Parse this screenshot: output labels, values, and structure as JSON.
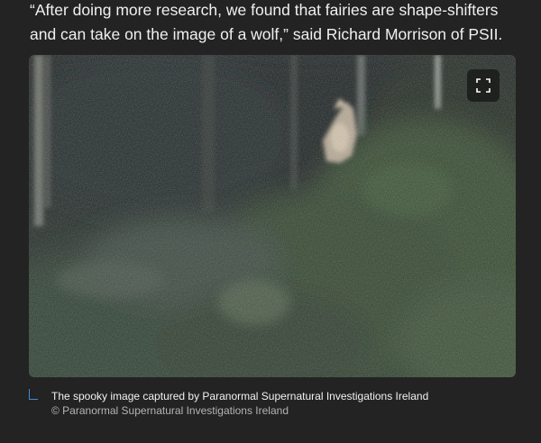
{
  "article": {
    "quote_line_1": "“After doing more research, we found that fairies are shape-shifters",
    "quote_line_2": "and can take on the image of a wolf,” said Richard Morrison of PSII."
  },
  "figure": {
    "expand_icon": "fullscreen-icon",
    "caption": "The spooky image captured by Paranormal Supernatural Investigations Ireland",
    "credit": "© Paranormal Supernatural Investigations Ireland"
  },
  "colors": {
    "background": "#232323",
    "accent": "#3f8ad8"
  }
}
